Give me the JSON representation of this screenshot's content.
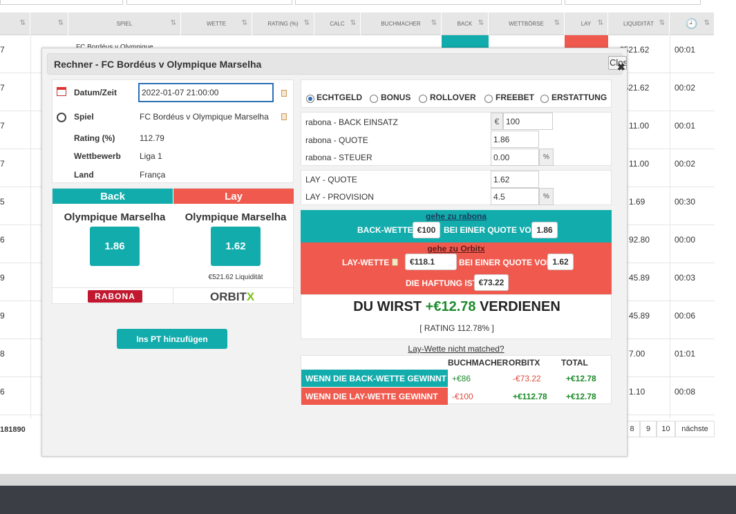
{
  "table": {
    "headers": [
      "SPIEL",
      "WETTE",
      "RATING (%)",
      "CALC",
      "BUCHMACHER",
      "BACK",
      "WETTBÖRSE",
      "LAY",
      "LIQUIDITÄT"
    ],
    "clock_icon": "clock-icon",
    "rows": [
      {
        "left": "7",
        "liq": "€521.62",
        "time": "00:01",
        "game": "FC Bordéus v Olympique ..."
      },
      {
        "left": "7",
        "liq": "€521.62",
        "time": "00:02"
      },
      {
        "left": "7",
        "liq": "11.00",
        "time": "00:01"
      },
      {
        "left": "7",
        "liq": "11.00",
        "time": "00:02"
      },
      {
        "left": "5",
        "liq": "1.69",
        "time": "00:30"
      },
      {
        "left": "6",
        "liq": "92.80",
        "time": "00:00"
      },
      {
        "left": "9",
        "liq": "45.89",
        "time": "00:03"
      },
      {
        "left": "9",
        "liq": "45.89",
        "time": "00:06"
      },
      {
        "left": "8",
        "liq": "7.00",
        "time": "01:01"
      },
      {
        "left": "6",
        "liq": "1.10",
        "time": "00:08"
      }
    ],
    "footer_count": "181890",
    "pager": [
      "8",
      "9",
      "10",
      "nächste"
    ]
  },
  "modal": {
    "title": "Rechner - FC Bordéus v Olympique Marselha",
    "close_label": "Close",
    "info": {
      "datetime_label": "Datum/Zeit",
      "datetime_value": "2022-01-07 21:00:00",
      "game_label": "Spiel",
      "game_value": "FC Bordéus v Olympique Marselha",
      "rating_label": "Rating (%)",
      "rating_value": "112.79",
      "competition_label": "Wettbewerb",
      "competition_value": "Liga 1",
      "country_label": "Land",
      "country_value": "França"
    },
    "back": {
      "header": "Back",
      "team": "Olympique Marselha",
      "odds": "1.86",
      "bookmaker_logo": "RABONA"
    },
    "lay": {
      "header": "Lay",
      "team": "Olympique Marselha",
      "odds": "1.62",
      "liquidity": "€521.62 Liquidität",
      "exchange_logo_text": "ORBIT",
      "exchange_logo_x": "X"
    },
    "add_button": "Ins PT hinzufügen",
    "bet_types": [
      "ECHTGELD",
      "BONUS",
      "ROLLOVER",
      "FREEBET",
      "ERSTATTUNG"
    ],
    "selected_bet_type": "ECHTGELD",
    "back_inputs": {
      "stake_label": "rabona - BACK EINSATZ",
      "stake_currency": "€",
      "stake_value": "100",
      "odds_label": "rabona - QUOTE",
      "odds_value": "1.86",
      "tax_label": "rabona - STEUER",
      "tax_value": "0.00",
      "tax_unit": "%"
    },
    "lay_inputs": {
      "odds_label": "LAY - QUOTE",
      "odds_value": "1.62",
      "commission_label": "LAY - PROVISION",
      "commission_value": "4.5",
      "commission_unit": "%"
    },
    "back_result": {
      "link": "gehe zu rabona",
      "prefix": "BACK-WETTE",
      "stake": "€100",
      "mid": "BEI EINER QUOTE VON",
      "odds": "1.86"
    },
    "lay_result": {
      "link": "gehe zu Orbitx",
      "prefix": "LAY-WETTE",
      "stake": "€118.1",
      "mid": "BEI EINER QUOTE VON",
      "odds": "1.62",
      "liability_label": "DIE HAFTUNG IST",
      "liability": "€73.22"
    },
    "profit": {
      "prefix": "DU WIRST",
      "amount": "+€12.78",
      "suffix": "VERDIENEN",
      "rating": "[ RATING 112.78% ]"
    },
    "not_matched_link": "Lay-Wette nicht matched?",
    "outcome": {
      "col_bookmaker": "BUCHMACHER",
      "col_exchange": "ORBITX",
      "col_total": "TOTAL",
      "rows": [
        {
          "label": "WENN DIE BACK-WETTE GEWINNT",
          "bookmaker": "+€86",
          "exchange": "-€73.22",
          "total": "+€12.78"
        },
        {
          "label": "WENN DIE LAY-WETTE GEWINNT",
          "bookmaker": "-€100",
          "exchange": "+€112.78",
          "total": "+€12.78"
        }
      ]
    }
  },
  "colors": {
    "teal": "#13acac",
    "red": "#f05a4e",
    "green": "#1c8a2a",
    "neg": "#e04a3a"
  }
}
